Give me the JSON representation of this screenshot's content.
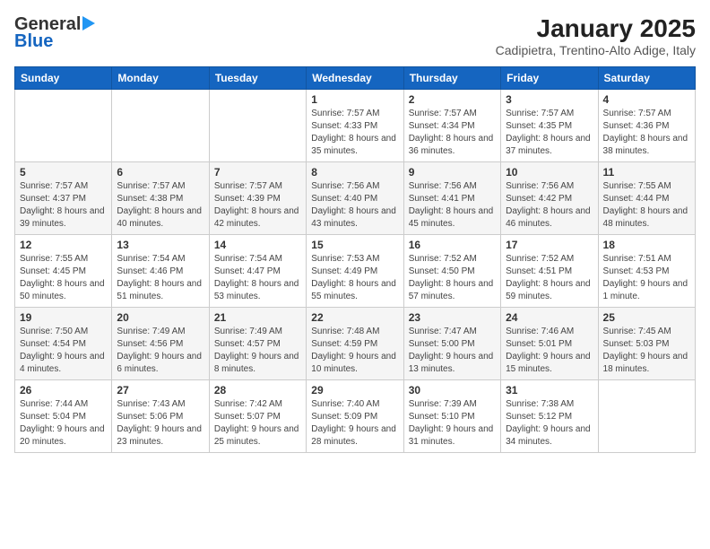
{
  "logo": {
    "general": "General",
    "blue": "Blue"
  },
  "title": "January 2025",
  "subtitle": "Cadipietra, Trentino-Alto Adige, Italy",
  "days_of_week": [
    "Sunday",
    "Monday",
    "Tuesday",
    "Wednesday",
    "Thursday",
    "Friday",
    "Saturday"
  ],
  "weeks": [
    [
      {
        "day": "",
        "info": ""
      },
      {
        "day": "",
        "info": ""
      },
      {
        "day": "",
        "info": ""
      },
      {
        "day": "1",
        "info": "Sunrise: 7:57 AM\nSunset: 4:33 PM\nDaylight: 8 hours and 35 minutes."
      },
      {
        "day": "2",
        "info": "Sunrise: 7:57 AM\nSunset: 4:34 PM\nDaylight: 8 hours and 36 minutes."
      },
      {
        "day": "3",
        "info": "Sunrise: 7:57 AM\nSunset: 4:35 PM\nDaylight: 8 hours and 37 minutes."
      },
      {
        "day": "4",
        "info": "Sunrise: 7:57 AM\nSunset: 4:36 PM\nDaylight: 8 hours and 38 minutes."
      }
    ],
    [
      {
        "day": "5",
        "info": "Sunrise: 7:57 AM\nSunset: 4:37 PM\nDaylight: 8 hours and 39 minutes."
      },
      {
        "day": "6",
        "info": "Sunrise: 7:57 AM\nSunset: 4:38 PM\nDaylight: 8 hours and 40 minutes."
      },
      {
        "day": "7",
        "info": "Sunrise: 7:57 AM\nSunset: 4:39 PM\nDaylight: 8 hours and 42 minutes."
      },
      {
        "day": "8",
        "info": "Sunrise: 7:56 AM\nSunset: 4:40 PM\nDaylight: 8 hours and 43 minutes."
      },
      {
        "day": "9",
        "info": "Sunrise: 7:56 AM\nSunset: 4:41 PM\nDaylight: 8 hours and 45 minutes."
      },
      {
        "day": "10",
        "info": "Sunrise: 7:56 AM\nSunset: 4:42 PM\nDaylight: 8 hours and 46 minutes."
      },
      {
        "day": "11",
        "info": "Sunrise: 7:55 AM\nSunset: 4:44 PM\nDaylight: 8 hours and 48 minutes."
      }
    ],
    [
      {
        "day": "12",
        "info": "Sunrise: 7:55 AM\nSunset: 4:45 PM\nDaylight: 8 hours and 50 minutes."
      },
      {
        "day": "13",
        "info": "Sunrise: 7:54 AM\nSunset: 4:46 PM\nDaylight: 8 hours and 51 minutes."
      },
      {
        "day": "14",
        "info": "Sunrise: 7:54 AM\nSunset: 4:47 PM\nDaylight: 8 hours and 53 minutes."
      },
      {
        "day": "15",
        "info": "Sunrise: 7:53 AM\nSunset: 4:49 PM\nDaylight: 8 hours and 55 minutes."
      },
      {
        "day": "16",
        "info": "Sunrise: 7:52 AM\nSunset: 4:50 PM\nDaylight: 8 hours and 57 minutes."
      },
      {
        "day": "17",
        "info": "Sunrise: 7:52 AM\nSunset: 4:51 PM\nDaylight: 8 hours and 59 minutes."
      },
      {
        "day": "18",
        "info": "Sunrise: 7:51 AM\nSunset: 4:53 PM\nDaylight: 9 hours and 1 minute."
      }
    ],
    [
      {
        "day": "19",
        "info": "Sunrise: 7:50 AM\nSunset: 4:54 PM\nDaylight: 9 hours and 4 minutes."
      },
      {
        "day": "20",
        "info": "Sunrise: 7:49 AM\nSunset: 4:56 PM\nDaylight: 9 hours and 6 minutes."
      },
      {
        "day": "21",
        "info": "Sunrise: 7:49 AM\nSunset: 4:57 PM\nDaylight: 9 hours and 8 minutes."
      },
      {
        "day": "22",
        "info": "Sunrise: 7:48 AM\nSunset: 4:59 PM\nDaylight: 9 hours and 10 minutes."
      },
      {
        "day": "23",
        "info": "Sunrise: 7:47 AM\nSunset: 5:00 PM\nDaylight: 9 hours and 13 minutes."
      },
      {
        "day": "24",
        "info": "Sunrise: 7:46 AM\nSunset: 5:01 PM\nDaylight: 9 hours and 15 minutes."
      },
      {
        "day": "25",
        "info": "Sunrise: 7:45 AM\nSunset: 5:03 PM\nDaylight: 9 hours and 18 minutes."
      }
    ],
    [
      {
        "day": "26",
        "info": "Sunrise: 7:44 AM\nSunset: 5:04 PM\nDaylight: 9 hours and 20 minutes."
      },
      {
        "day": "27",
        "info": "Sunrise: 7:43 AM\nSunset: 5:06 PM\nDaylight: 9 hours and 23 minutes."
      },
      {
        "day": "28",
        "info": "Sunrise: 7:42 AM\nSunset: 5:07 PM\nDaylight: 9 hours and 25 minutes."
      },
      {
        "day": "29",
        "info": "Sunrise: 7:40 AM\nSunset: 5:09 PM\nDaylight: 9 hours and 28 minutes."
      },
      {
        "day": "30",
        "info": "Sunrise: 7:39 AM\nSunset: 5:10 PM\nDaylight: 9 hours and 31 minutes."
      },
      {
        "day": "31",
        "info": "Sunrise: 7:38 AM\nSunset: 5:12 PM\nDaylight: 9 hours and 34 minutes."
      },
      {
        "day": "",
        "info": ""
      }
    ]
  ]
}
